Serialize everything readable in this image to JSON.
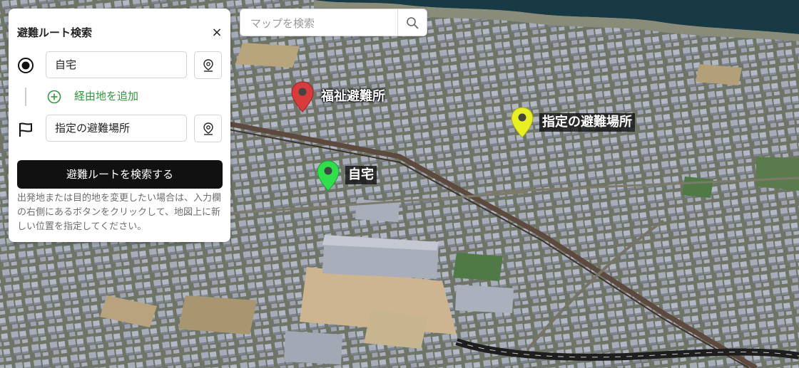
{
  "panel": {
    "title": "避難ルート検索",
    "close_label": "×",
    "origin_value": "自宅",
    "add_waypoint_label": "経由地を追加",
    "destination_value": "指定の避難場所",
    "search_button_label": "避難ルートを検索する",
    "help_text": "出発地または目的地を変更したい場合は、入力欄の右側にあるボタンをクリックして、地図上に新しい位置を指定してください。",
    "origin_icon": "radio-target-icon",
    "destination_icon": "flag-icon",
    "pick_icon": "map-pin-icon",
    "add_icon": "plus-circle-icon"
  },
  "map_search": {
    "placeholder": "マップを検索",
    "button_icon": "search-icon"
  },
  "markers": [
    {
      "label": "福祉避難所",
      "color": "#d93a3a",
      "label_style": "outline"
    },
    {
      "label": "指定の避難場所",
      "color": "#e8f020",
      "label_style": "boxed"
    },
    {
      "label": "自宅",
      "color": "#2ee04a",
      "label_style": "boxed"
    }
  ],
  "colors": {
    "accent_green": "#2e9a3c",
    "primary_button": "#111111",
    "water": "#173a44"
  }
}
